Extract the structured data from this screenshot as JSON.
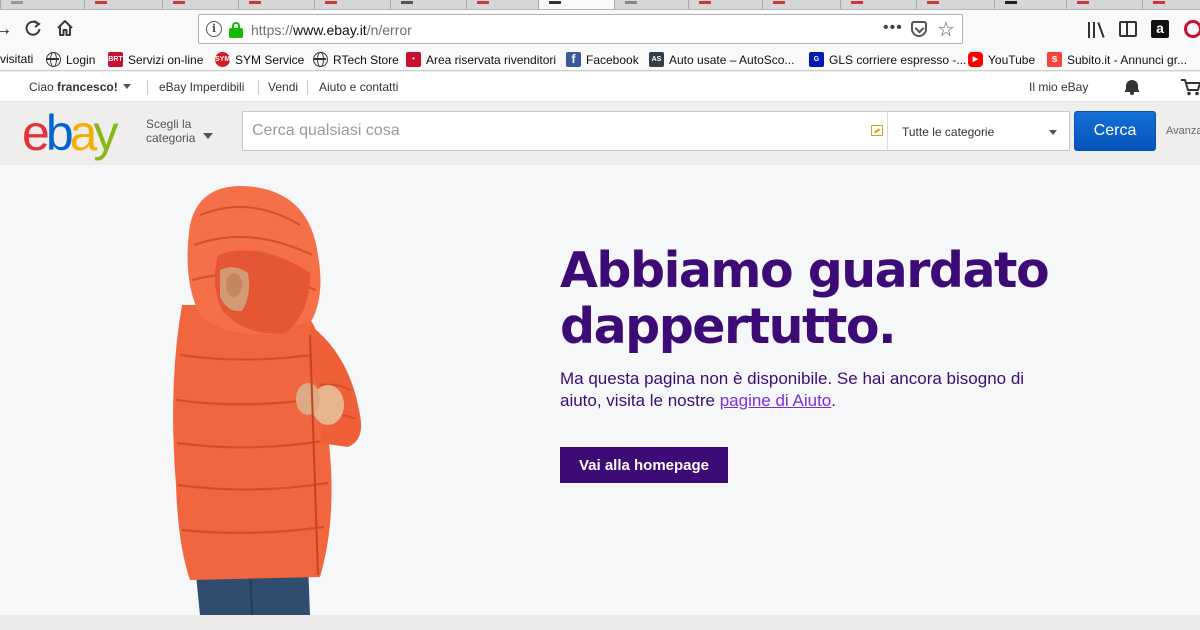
{
  "browser": {
    "url_protocol": "https://",
    "url_domain": "www.ebay.it",
    "url_path": "/n/error",
    "url_more": "•••"
  },
  "bookmarks": [
    {
      "label": "visitati",
      "icon": "none"
    },
    {
      "label": "Login",
      "icon": "globe-icon"
    },
    {
      "label": "Servizi on-line",
      "icon": "brt-icon",
      "badge": "BRT",
      "color": "#c8102e"
    },
    {
      "label": "SYM Service",
      "icon": "sym-icon",
      "badge": "SYM",
      "color": "#d71920"
    },
    {
      "label": "RTech Store",
      "icon": "globe-icon"
    },
    {
      "label": "Area riservata rivenditori",
      "icon": "dealer-icon",
      "badge": "•",
      "color": "#c8102e"
    },
    {
      "label": "Facebook",
      "icon": "facebook-icon",
      "badge": "f",
      "color": "#3b5998"
    },
    {
      "label": "Auto usate – AutoSco...",
      "icon": "autoscout-icon",
      "badge": "AS",
      "color": "#333f48"
    },
    {
      "label": "GLS corriere espresso -...",
      "icon": "gls-icon",
      "badge": "G",
      "color": "#061ab1"
    },
    {
      "label": "YouTube",
      "icon": "youtube-icon",
      "badge": "▶",
      "color": "#ff0000"
    },
    {
      "label": "Subito.it - Annunci gr...",
      "icon": "subito-icon",
      "badge": "s",
      "color": "#f9423a"
    }
  ],
  "ebay_top": {
    "greeting_prefix": "Ciao ",
    "greeting_name": "francesco!",
    "daily_deals": "eBay Imperdibili",
    "sell": "Vendi",
    "help_contact": "Aiuto e contatti",
    "my_ebay": "Il mio eBay"
  },
  "header": {
    "logo": {
      "e": "e",
      "b": "b",
      "a": "a",
      "y": "y"
    },
    "shop_by_category_line1": "Scegli la",
    "shop_by_category_line2": "categoria",
    "search_placeholder": "Cerca qualsiasi cosa",
    "category_selected": "Tutte le categorie",
    "search_button": "Cerca",
    "advanced": "Avanzata"
  },
  "error": {
    "headline_line1": "Abbiamo guardato",
    "headline_line2": "dappertutto.",
    "body_before_link": "Ma questa pagina non è disponibile. Se hai ancora bisogno di aiuto, visita le nostre ",
    "help_link": "pagine di Aiuto",
    "body_after_link": ".",
    "home_button": "Vai alla homepage"
  },
  "colors": {
    "ebay_red": "#e53238",
    "ebay_blue": "#0064d2",
    "ebay_yellow": "#f5af02",
    "ebay_green": "#86b817",
    "headline_purple": "#3c0b76",
    "link_purple": "#7b2ee0",
    "search_button_blue": "#0654ba",
    "jacket_orange": "#f2663f"
  }
}
